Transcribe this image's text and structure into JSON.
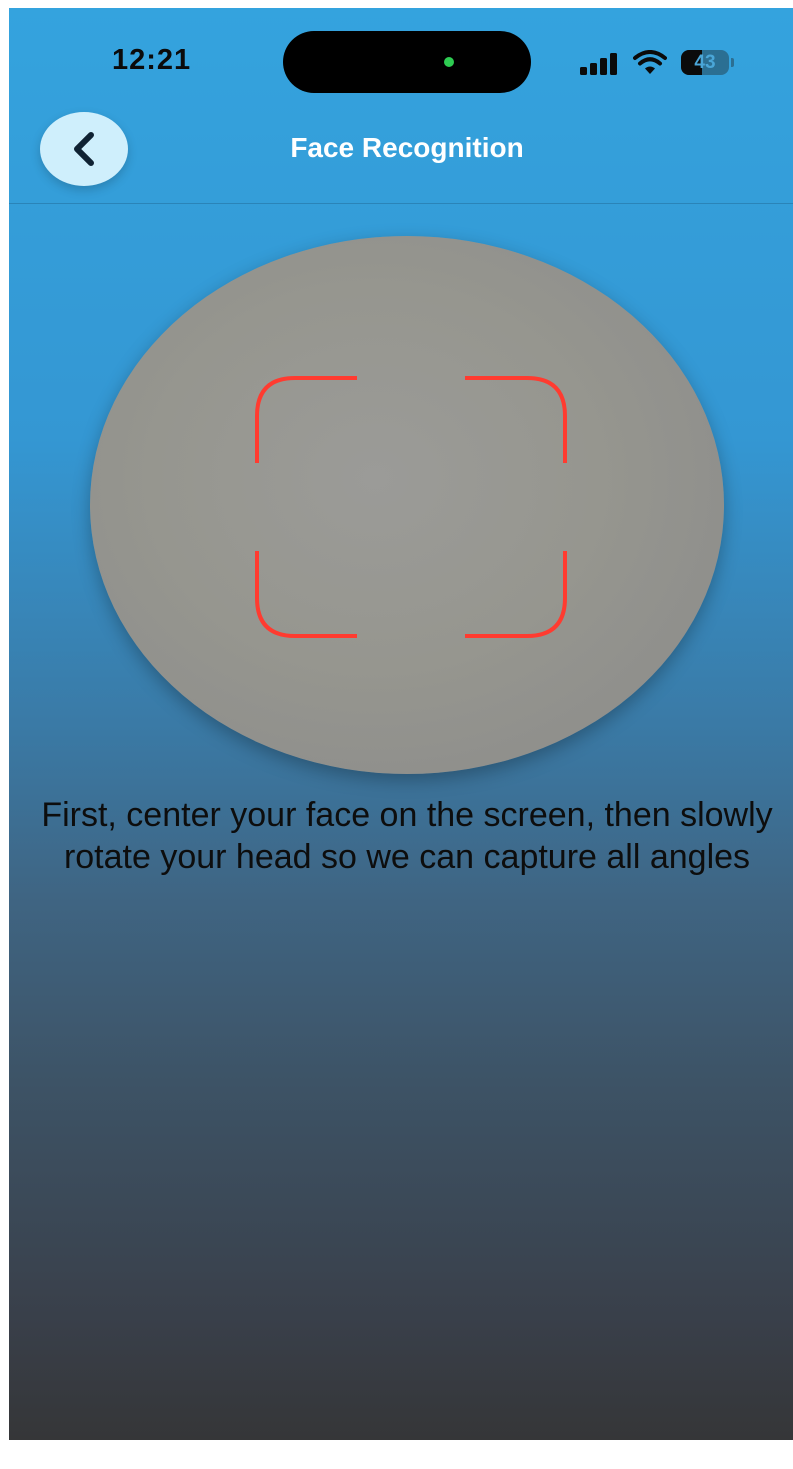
{
  "status_bar": {
    "time": "12:21",
    "battery_level": "43",
    "battery_fraction": 0.43,
    "icons": [
      "cellular-signal-icon",
      "wifi-icon",
      "battery-icon"
    ]
  },
  "header": {
    "back_icon": "chevron-left-icon",
    "title": "Face Recognition"
  },
  "camera": {
    "frame_color": "#ff3b30",
    "frame_icon": "face-scan-frame-icon"
  },
  "instruction": {
    "text": "First, center your face on the screen, then slowly rotate your head so we can capture all angles"
  },
  "colors": {
    "background_top": "#34a3de",
    "background_bottom": "#353638",
    "back_button": "#cfeffc",
    "island_indicator": "#2ecc52"
  }
}
